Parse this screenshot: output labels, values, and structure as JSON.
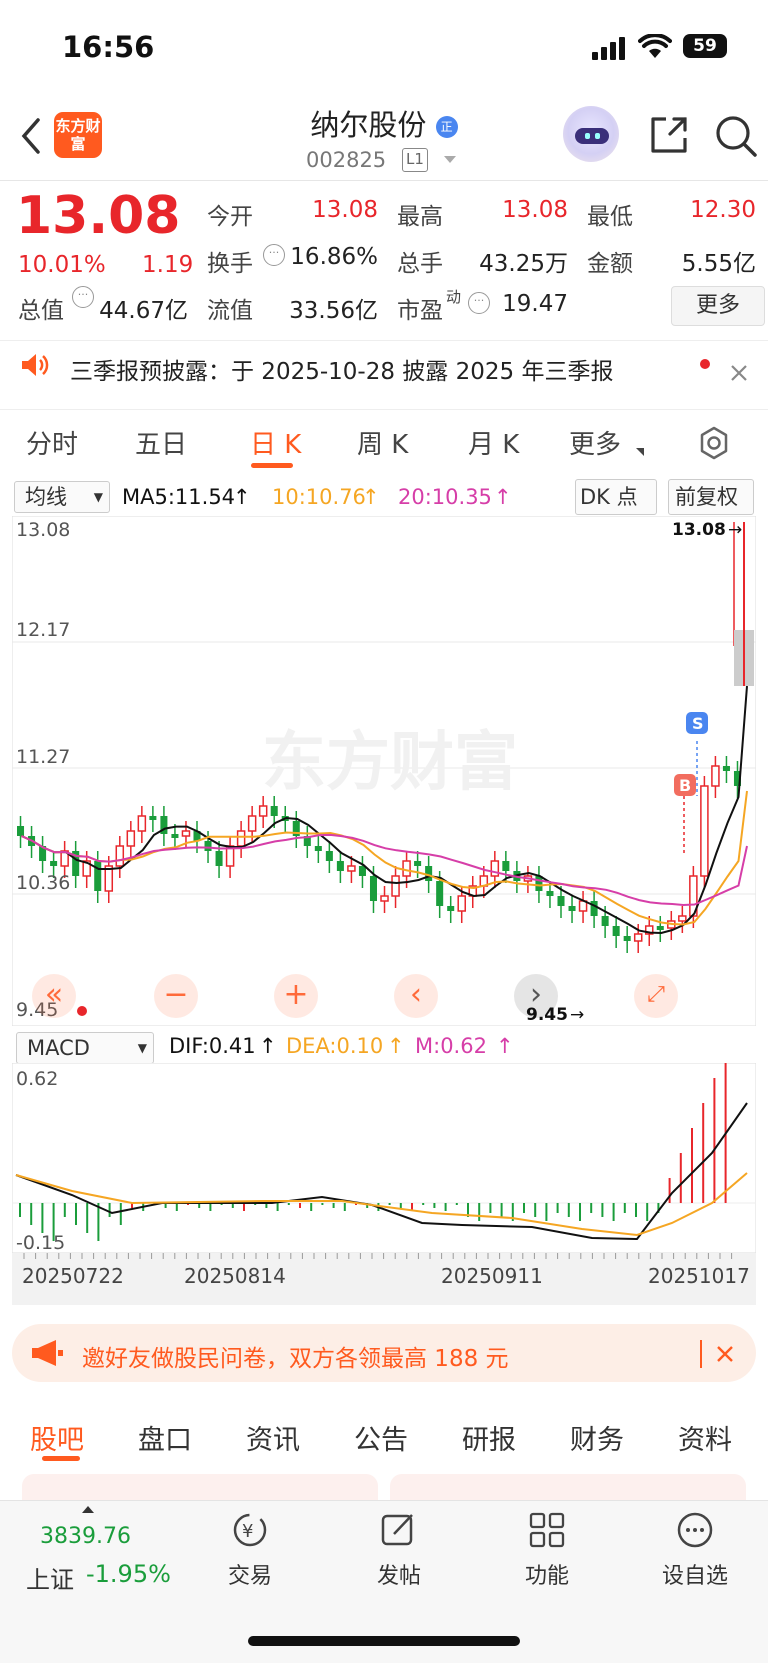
{
  "status_bar": {
    "time": "16:56",
    "battery": "59"
  },
  "header": {
    "logo_text": "东方财富",
    "stock_name": "纳尔股份",
    "stock_code": "002825",
    "level_badge": "L1"
  },
  "quote": {
    "price": "13.08",
    "change_pct": "10.01%",
    "change": "1.19",
    "fields": [
      {
        "label": "今开",
        "value": "13.08"
      },
      {
        "label": "最高",
        "value": "13.08"
      },
      {
        "label": "最低",
        "value": "12.30"
      },
      {
        "label": "换手",
        "value": "16.86%"
      },
      {
        "label": "总手",
        "value": "43.25万"
      },
      {
        "label": "金额",
        "value": "5.55亿"
      },
      {
        "label": "总值",
        "value": "44.67亿"
      },
      {
        "label": "流值",
        "value": "33.56亿"
      },
      {
        "label": "市盈",
        "value": "19.47"
      }
    ],
    "pe_suffix": "动",
    "more_label": "更多"
  },
  "notice": {
    "text": "三季报预披露：于 2025-10-28 披露 2025 年三季报"
  },
  "kline_tabs": [
    "分时",
    "五日",
    "日 K",
    "周 K",
    "月 K",
    "更多"
  ],
  "chart_toolbar": {
    "indicator": "均线",
    "ma5": "MA5:11.54",
    "ma10": "10:10.76",
    "ma20": "20:10.35",
    "dk_label": "DK 点",
    "adjust_label": "前复权"
  },
  "price_axis": {
    "top": "13.08",
    "l2": "12.17",
    "l3": "11.27",
    "l4": "10.36",
    "bottom": "9.45",
    "max_marker": "13.08",
    "min_marker": "9.45"
  },
  "watermark": "东方财富",
  "signals": {
    "buy": "B",
    "sell": "S"
  },
  "macd_toolbar": {
    "indicator": "MACD",
    "dif": "DIF:0.41",
    "dea": "DEA:0.10",
    "m": "M:0.62"
  },
  "macd_axis": {
    "top": "0.62",
    "bottom": "-0.15"
  },
  "dates": [
    "20250722",
    "20250814",
    "20250911",
    "20251017"
  ],
  "colors": {
    "up": "#e8262b",
    "down": "#1a9d3b",
    "ma5": "#111111",
    "ma10": "#f5a623",
    "ma20": "#d63ea8",
    "accent": "#ff5a1f"
  },
  "banner": {
    "text": "邀好友做股民问卷，双方各领最高 188 元"
  },
  "content_tabs": [
    "股吧",
    "盘口",
    "资讯",
    "公告",
    "研报",
    "财务",
    "资料"
  ],
  "bottom_nav": {
    "index_value": "3839.76",
    "index_name": "上证",
    "index_change": "-1.95%",
    "items": [
      "交易",
      "发帖",
      "功能",
      "设自选"
    ]
  }
}
